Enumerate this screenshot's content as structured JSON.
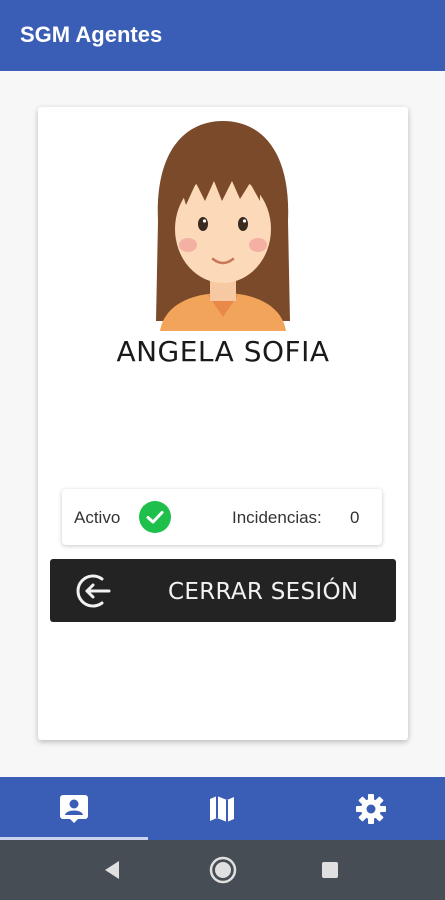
{
  "app_bar": {
    "title": "SGM Agentes",
    "color": "#3a5db5"
  },
  "profile": {
    "name": "ANGELA SOFIA",
    "avatar_icon": "girl-avatar-icon"
  },
  "status": {
    "state_label": "Activo",
    "state_icon": "check-circle-icon",
    "state_color": "#1fbf4b",
    "incidents_label": "Incidencias:",
    "incidents_value": "0"
  },
  "logout_button": {
    "label": "CERRAR SESIÓN",
    "icon": "logout-icon",
    "color": "#232323"
  },
  "bottom_nav": {
    "items": [
      {
        "icon": "profile-icon",
        "active": true
      },
      {
        "icon": "map-icon",
        "active": false
      },
      {
        "icon": "settings-icon",
        "active": false
      }
    ]
  },
  "system_nav": {
    "buttons": [
      "back-icon",
      "home-icon",
      "recents-icon"
    ]
  }
}
